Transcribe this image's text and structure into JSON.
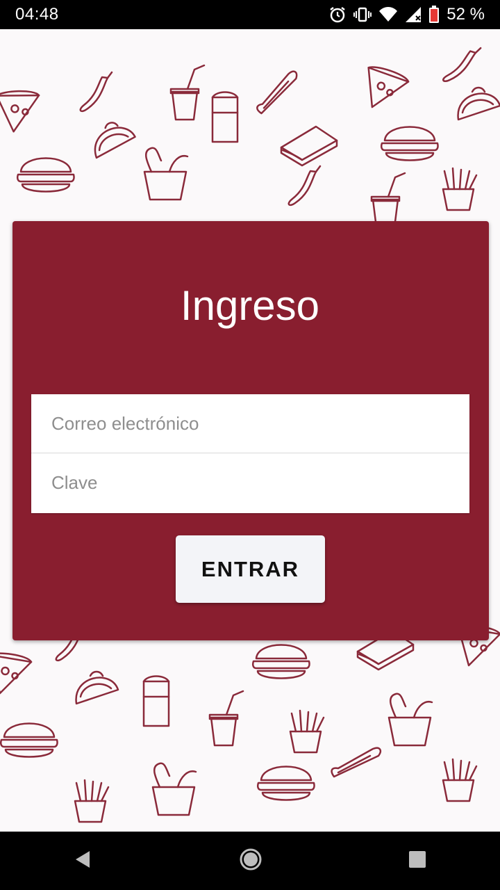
{
  "status_bar": {
    "time": "04:48",
    "battery_percent": "52 %",
    "icons": [
      "alarm-icon",
      "vibrate-icon",
      "wifi-icon",
      "signal-icon",
      "battery-icon"
    ]
  },
  "login": {
    "title": "Ingreso",
    "email_placeholder": "Correo electrónico",
    "password_placeholder": "Clave",
    "submit_label": "ENTRAR"
  },
  "nav_bar": {
    "icons": [
      "back-icon",
      "home-icon",
      "recents-icon"
    ]
  },
  "colors": {
    "card": "#891e2f",
    "doodle_stroke": "#8a2a3a",
    "background": "#fbf9fa"
  }
}
